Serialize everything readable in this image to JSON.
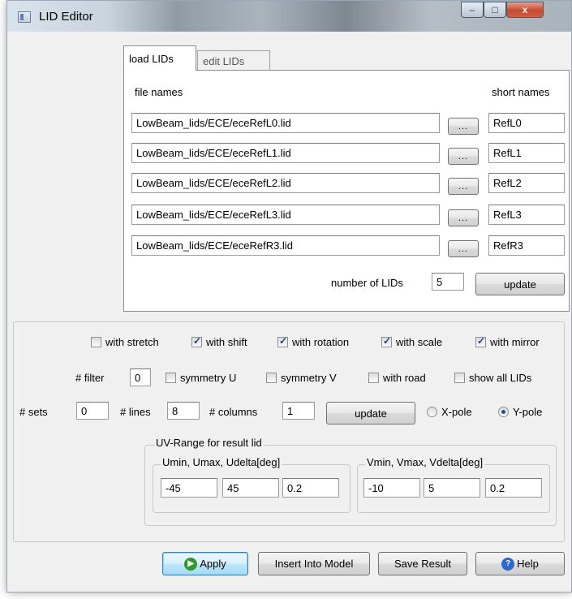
{
  "window": {
    "title": "LID Editor",
    "minimize": "–",
    "maximize": "□",
    "close": "x"
  },
  "tabs": {
    "load": "load LIDs",
    "edit": "edit LIDs"
  },
  "load": {
    "file_names_header": "file names",
    "short_names_header": "short names",
    "browse_label": "...",
    "rows": [
      {
        "file": "LowBeam_lids/ECE/eceRefL0.lid",
        "short": "RefL0"
      },
      {
        "file": "LowBeam_lids/ECE/eceRefL1.lid",
        "short": "RefL1"
      },
      {
        "file": "LowBeam_lids/ECE/eceRefL2.lid",
        "short": "RefL2"
      },
      {
        "file": "LowBeam_lids/ECE/eceRefL3.lid",
        "short": "RefL3"
      },
      {
        "file": "LowBeam_lids/ECE/eceRefR3.lid",
        "short": "RefR3"
      }
    ],
    "count_label": "number of LIDs",
    "count_value": "5",
    "update_label": "update"
  },
  "options": {
    "checks1": [
      {
        "label": "with stretch",
        "checked": false
      },
      {
        "label": "with shift",
        "checked": true
      },
      {
        "label": "with rotation",
        "checked": true
      },
      {
        "label": "with scale",
        "checked": true
      },
      {
        "label": "with mirror",
        "checked": true
      }
    ],
    "filter_label": "# filter",
    "filter_value": "0",
    "checks2": [
      {
        "label": "symmetry U",
        "checked": false
      },
      {
        "label": "symmetry V",
        "checked": false
      },
      {
        "label": "with road",
        "checked": false
      },
      {
        "label": "show all LIDs",
        "checked": false
      }
    ],
    "sets_label": "# sets",
    "sets_value": "0",
    "lines_label": "# lines",
    "lines_value": "8",
    "columns_label": "# columns",
    "columns_value": "1",
    "update_label": "update",
    "xpole_label": "X-pole",
    "ypole_label": "Y-pole",
    "pole_selected": "Y-pole"
  },
  "uv": {
    "group_label": "UV-Range for result lid",
    "u_label": "Umin, Umax, Udelta[deg]",
    "u_values": [
      "-45",
      "45",
      "0.2"
    ],
    "v_label": "Vmin, Vmax, Vdelta[deg]",
    "v_values": [
      "-10",
      "5",
      "0.2"
    ]
  },
  "buttons": {
    "apply": "Apply",
    "insert": "Insert Into Model",
    "save": "Save Result",
    "help": "Help"
  },
  "colors": {
    "apply_icon": "#2e9a2e",
    "help_icon": "#2a6bd1"
  }
}
